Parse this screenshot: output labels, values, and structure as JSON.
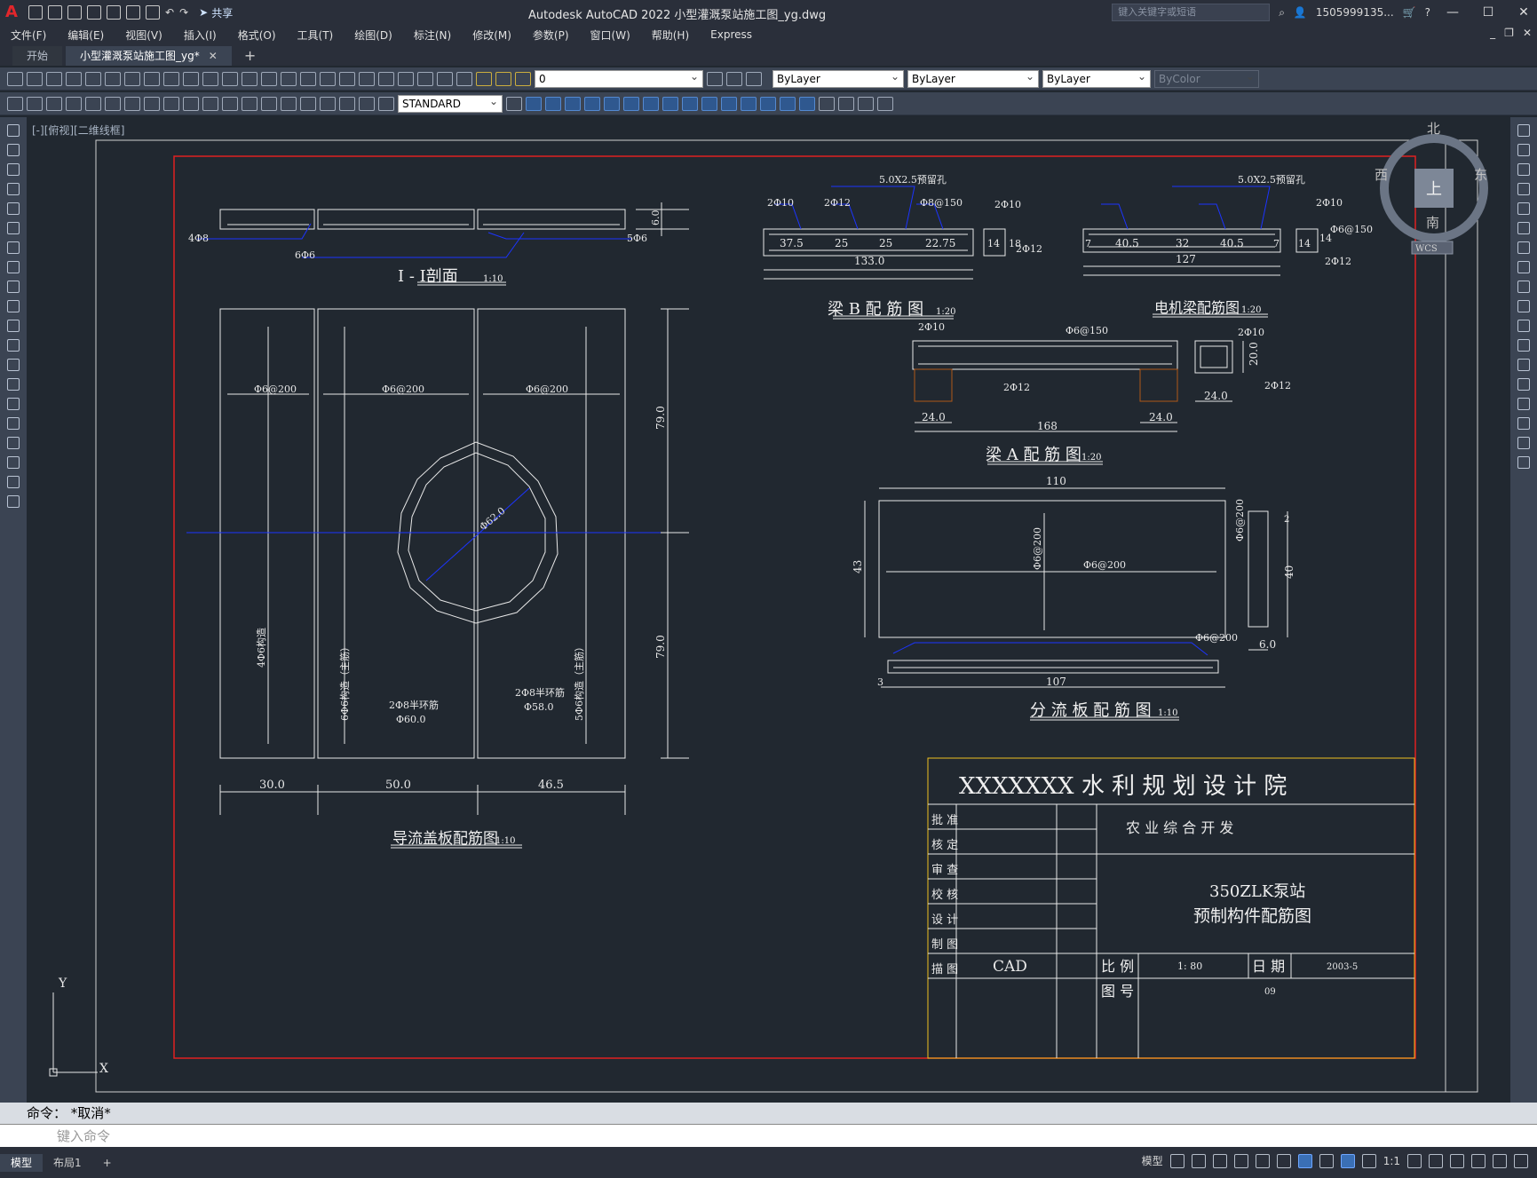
{
  "app": {
    "logo": "A",
    "title": "Autodesk AutoCAD 2022    小型灌溉泵站施工图_yg.dwg",
    "share_label": "共享",
    "search_placeholder": "键入关键字或短语",
    "user": "1505999135...",
    "minimize": "—",
    "maximize": "☐",
    "close": "✕"
  },
  "menu": [
    "文件(F)",
    "编辑(E)",
    "视图(V)",
    "插入(I)",
    "格式(O)",
    "工具(T)",
    "绘图(D)",
    "标注(N)",
    "修改(M)",
    "参数(P)",
    "窗口(W)",
    "帮助(H)",
    "Express"
  ],
  "tabs": {
    "start": "开始",
    "active": "小型灌溉泵站施工图_yg*",
    "close": "✕",
    "new": "+"
  },
  "toolbar": {
    "layer_value": "0",
    "color_value": "ByLayer",
    "linetype_value": "ByLayer",
    "lineweight_value": "ByLayer",
    "plotstyle_value": "ByColor",
    "textstyle_value": "STANDARD"
  },
  "viewport_label": "[-][俯视][二维线框]",
  "viewcube": {
    "north": "北",
    "south": "南",
    "east": "东",
    "west": "西",
    "top": "上",
    "wcs": "WCS"
  },
  "drawing": {
    "sec1_title": "I - I剖面",
    "sec1_scale": "1:10",
    "sec1_left": "4Φ8",
    "sec1_mid": "6Φ6",
    "sec1_right": "5Φ6",
    "sec1_dim": "6.0",
    "beamB_title": "梁 B 配 筋 图",
    "beamB_scale": "1:20",
    "beamB_hole": "5.0X2.5预留孔",
    "beamB_l1": "2Φ10",
    "beamB_l2": "2Φ12",
    "beamB_l3": "Φ8@150",
    "beamB_l4": "2Φ10",
    "beamB_l5": "2Φ12",
    "beamB_d1": "37.5",
    "beamB_d2": "25",
    "beamB_d3": "25",
    "beamB_d4": "22.75",
    "beamB_total": "133.0",
    "beamB_s1": "14",
    "beamB_s2": "18",
    "motor_title": "电机梁配筋图",
    "motor_scale": "1:20",
    "motor_hole": "5.0X2.5预留孔",
    "motor_l1": "2Φ10",
    "motor_l2": "Φ6@150",
    "motor_l3": "2Φ12",
    "motor_d1": "7",
    "motor_d2": "40.5",
    "motor_d3": "32",
    "motor_d4": "40.5",
    "motor_d5": "7",
    "motor_total": "127",
    "motor_s1": "14",
    "motor_s2": "14",
    "beamA_title": "梁 A 配 筋 图",
    "beamA_scale": "1:20",
    "beamA_l1": "2Φ10",
    "beamA_l2": "Φ6@150",
    "beamA_l3": "2Φ12",
    "beamA_l4": "2Φ10",
    "beamA_l5": "2Φ12",
    "beamA_d1": "24.0",
    "beamA_d2": "24.0",
    "beamA_total": "168",
    "beamA_s1": "24.0",
    "beamA_s2": "20.0",
    "cover_title": "导流盖板配筋图",
    "cover_scale": "1:10",
    "cover_r1": "Φ6@200",
    "cover_r2": "Φ6@200",
    "cover_r3": "Φ6@200",
    "cover_dia": "Φ62.0",
    "cover_left_bars": "4Φ6构造",
    "cover_mid_bars": "6Φ6构造（主筋）",
    "cover_right_bars": "5Φ6构造（主筋）",
    "cover_ring_l": "2Φ8半环筋",
    "cover_ring_l2": "Φ60.0",
    "cover_ring_r": "2Φ8半环筋",
    "cover_ring_r2": "Φ58.0",
    "cover_d1": "30.0",
    "cover_d2": "50.0",
    "cover_d3": "46.5",
    "cover_h1": "79.0",
    "cover_h2": "79.0",
    "div_title": "分 流 板 配 筋 图",
    "div_scale": "1:10",
    "div_w": "110",
    "div_h": "43",
    "div_r1": "Φ6@200",
    "div_r2": "Φ6@200",
    "div_r3": "Φ6@200",
    "div_r4": "Φ6@200",
    "div_side": "40",
    "div_side2": "2",
    "div_t": "6.0",
    "div_bottom": "107",
    "div_b2": "3"
  },
  "titleblock": {
    "institute": "XXXXXXX 水 利 规 划 设 计 院",
    "rows": [
      "批 准",
      "核 定",
      "审 查",
      "校 核",
      "设 计",
      "制 图",
      "描 图"
    ],
    "project": "农 业 综 合 开 发",
    "name1": "350ZLK泵站",
    "name2": "预制构件配筋图",
    "drafter": "CAD",
    "scale_label": "比 例",
    "scale_value": "1: 80",
    "date_label": "日 期",
    "date_value": "2003-5",
    "no_label": "图 号",
    "no_value": "09"
  },
  "axis": {
    "y": "Y",
    "x": "X"
  },
  "command": {
    "history": "命令： *取消*",
    "placeholder": "键入命令"
  },
  "status": {
    "model": "模型",
    "layout1": "布局1",
    "add": "+",
    "model_btn": "模型",
    "scale": "1:1"
  }
}
